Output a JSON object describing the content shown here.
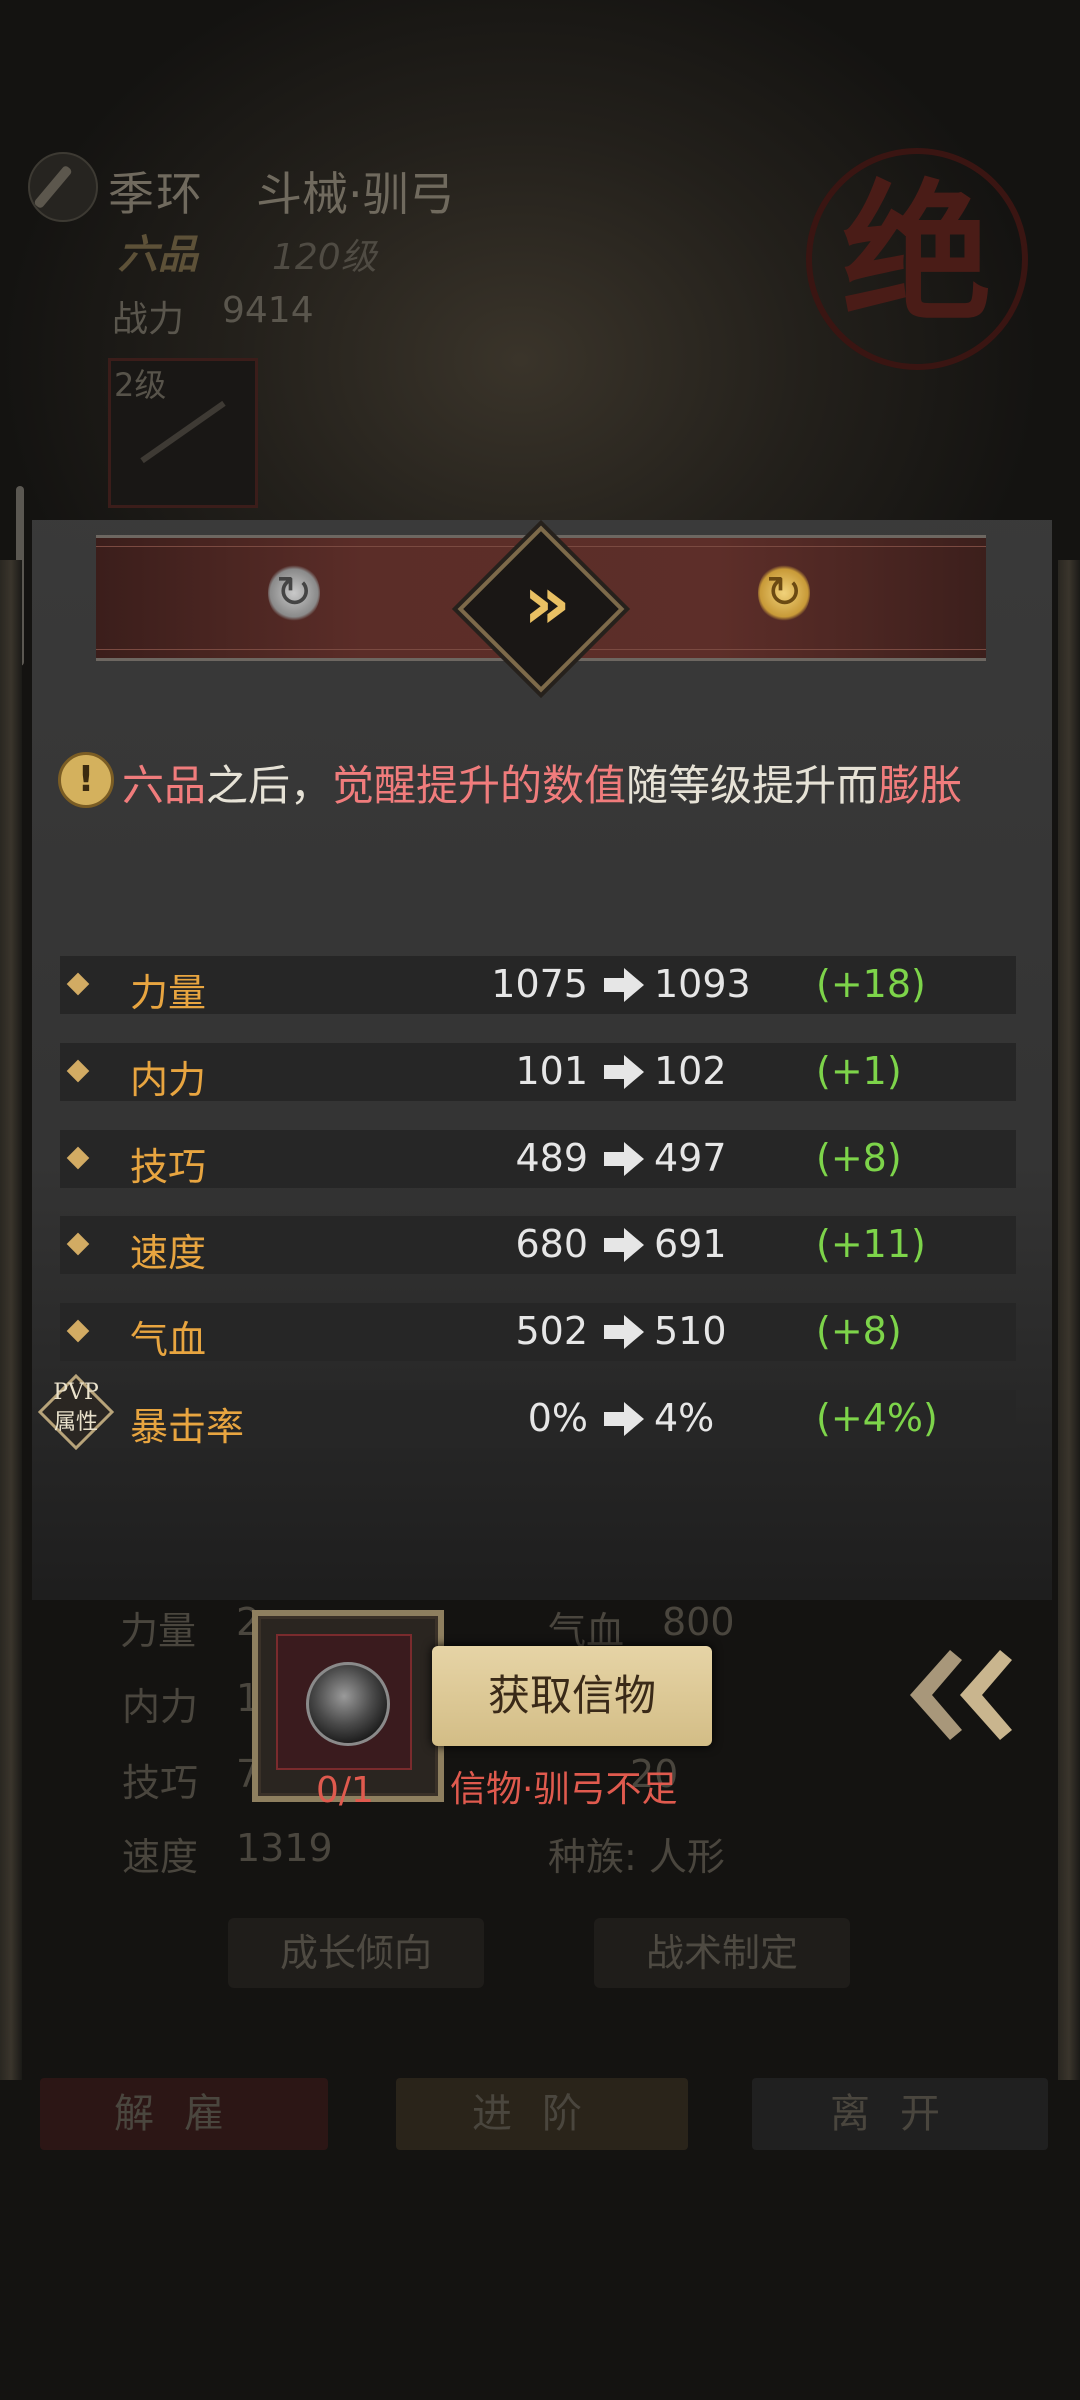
{
  "hero": {
    "name": "季环",
    "class": "斗械·驯弓",
    "grade": "六品",
    "level": "120级",
    "power_label": "战力",
    "power_value": "9414",
    "equip_level": "2级",
    "seal_char": "绝"
  },
  "awaken": {
    "current_icon": "awaken-gray-icon",
    "next_icon": "awaken-gold-icon",
    "arrow_icon": "double-chevron-right-icon"
  },
  "notice": {
    "part1": "六品",
    "part2": "之后，",
    "part3": "觉醒提升的数值",
    "part4": "随等级提升而",
    "part5": "膨胀"
  },
  "stats": [
    {
      "name": "力量",
      "old": "1075",
      "new": "1093",
      "delta": "(+18)"
    },
    {
      "name": "内力",
      "old": "101",
      "new": "102",
      "delta": "(+1)"
    },
    {
      "name": "技巧",
      "old": "489",
      "new": "497",
      "delta": "(+8)"
    },
    {
      "name": "速度",
      "old": "680",
      "new": "691",
      "delta": "(+11)"
    },
    {
      "name": "气血",
      "old": "502",
      "new": "510",
      "delta": "(+8)"
    },
    {
      "name": "暴击率",
      "old": "0%",
      "new": "4%",
      "delta": "(+4%)"
    }
  ],
  "pvp_badge": {
    "line1": "PVP",
    "line2": "属性"
  },
  "item": {
    "count": "0/1",
    "get_label": "获取信物",
    "warning": "信物·驯弓不足"
  },
  "background_info": {
    "str_label": "力量",
    "str_value": "2",
    "hp_label": "气血",
    "hp_value": "800",
    "int_label": "内力",
    "int_value": "1",
    "skill_label": "技巧",
    "skill_value": "7",
    "other_value": "20",
    "speed_label": "速度",
    "speed_value": "1319",
    "race": "种族: 人形",
    "growth_btn": "成长倾向",
    "tactic_btn": "战术制定"
  },
  "bottom_buttons": {
    "dismiss": "解雇",
    "advance": "进阶",
    "leave": "离开"
  },
  "colors": {
    "stat_name": "#e8a540",
    "delta": "#7dd44a",
    "highlight": "#f07c7c",
    "warning": "#e05a4e"
  }
}
